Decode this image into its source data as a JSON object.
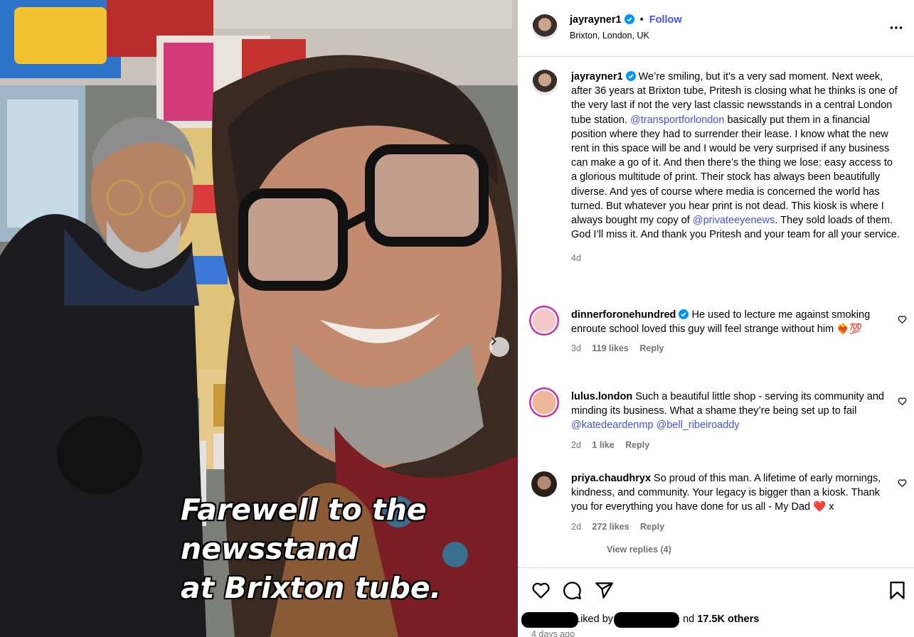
{
  "post": {
    "caption_overlay": [
      "Farewell to the",
      "newsstand",
      "at Brixton tube."
    ],
    "author": {
      "username": "jayrayner1",
      "follow_label": "Follow",
      "separator": "•",
      "location": "Brixton, London, UK"
    },
    "caption": {
      "username": "jayrayner1",
      "text_1": " We’re smiling, but it’s a very sad moment. Next week, after 36 years at Brixton tube, Pritesh is closing what he thinks is one of the very last if not the very last classic newsstands in a central London tube station. ",
      "mention_1": "@transportforlondon",
      "text_2": " basically put them in a financial position where they had to surrender their lease. I know what the new rent in this space will be and I would be very surprised if any business can make a go of it. And then there’s the thing we lose: easy access to a glorious multitude of print. Their stock has always been beautifully diverse. And yes of course where media is concerned the world has turned. But whatever you hear print is not dead. This kiosk is where I always bought my copy of ",
      "mention_2": "@privateeyenews",
      "text_3": ". They sold loads of them. God I’ll miss it. And thank you Pritesh and your team for all your service.",
      "age": "4d"
    },
    "comments": [
      {
        "username": "dinnerforonehundred",
        "text": " He used to lecture me against smoking enroute school loved this guy will feel strange without him ❤️‍🔥💯",
        "age": "3d",
        "likes": "119 likes",
        "reply": "Reply"
      },
      {
        "username": "lulus.london",
        "text": " Such a beautiful little shop - serving its community and minding its business. What a shame they’re being set up to fail ",
        "mention_1": "@katedeardenmp",
        "mention_2": "@bell_ribeiroaddy",
        "age": "2d",
        "likes": "1 like",
        "reply": "Reply"
      },
      {
        "username": "priya.chaudhryx",
        "text": " So proud of this man. A lifetime of early mornings, kindness, and community. Your legacy is bigger than a kiosk. Thank you for everything you have done for us all - My Dad ❤️ x",
        "age": "2d",
        "likes": "272 likes",
        "reply": "Reply",
        "view_replies": "View replies (4)"
      }
    ],
    "footer": {
      "liked_by": "Liked by",
      "and_label": "nd",
      "others": "17.5K others",
      "timestamp": "4 days ago"
    },
    "icons": {
      "like": "heart-icon",
      "comment": "comment-icon",
      "share": "share-icon",
      "save": "bookmark-icon",
      "more": "more-options-icon",
      "next": "chevron-right-icon",
      "verified": "verified-badge-icon"
    },
    "colors": {
      "link": "#4150f7",
      "verified": "#0095f6",
      "muted": "#737373",
      "border": "#dbdbdb"
    }
  }
}
